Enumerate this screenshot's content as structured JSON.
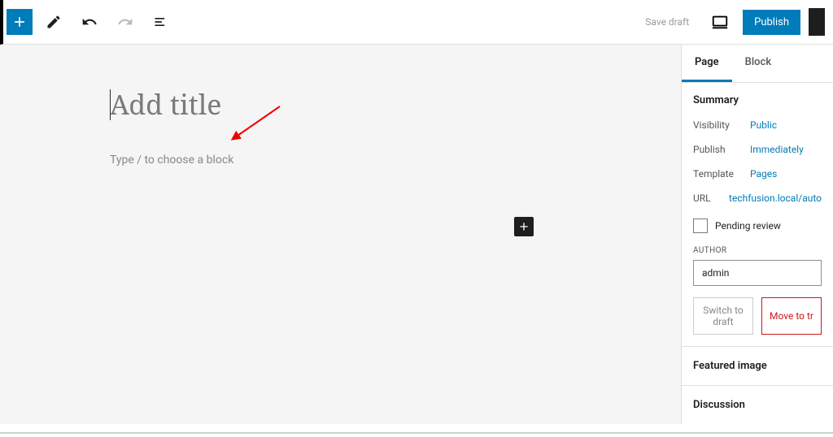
{
  "toolbar": {
    "save_draft": "Save draft",
    "publish": "Publish"
  },
  "editor": {
    "title_placeholder": "Add title",
    "block_placeholder": "Type / to choose a block"
  },
  "sidebar": {
    "tabs": {
      "page": "Page",
      "block": "Block"
    },
    "summary": {
      "heading": "Summary",
      "visibility_label": "Visibility",
      "visibility_value": "Public",
      "publish_label": "Publish",
      "publish_value": "Immediately",
      "template_label": "Template",
      "template_value": "Pages",
      "url_label": "URL",
      "url_value": "techfusion.local/auto",
      "pending_review": "Pending review",
      "author_label": "AUTHOR",
      "author_value": "admin",
      "switch_to_draft": "Switch to draft",
      "move_to_trash": "Move to tr"
    },
    "featured_image": "Featured image",
    "discussion": "Discussion"
  }
}
